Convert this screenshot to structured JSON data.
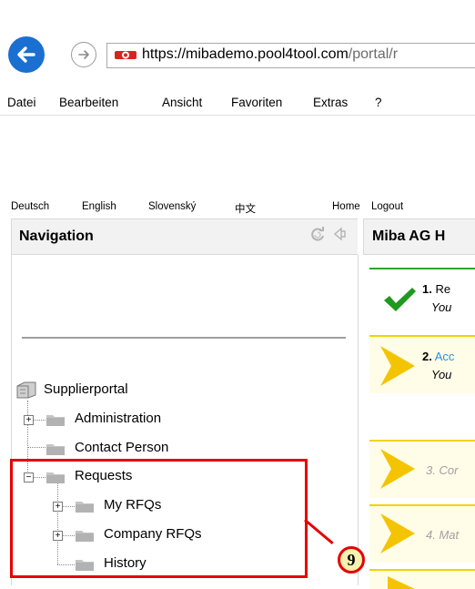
{
  "browser": {
    "url_prefix": "https://mibademo.",
    "url_domain": "pool4tool.com",
    "url_path": "/portal/r",
    "menu": [
      "Datei",
      "Bearbeiten",
      "Ansicht",
      "Favoriten",
      "Extras",
      "?"
    ]
  },
  "languages": [
    "Deutsch",
    "English",
    "Slovenský",
    "中文"
  ],
  "top_links": [
    "Home",
    "Logout"
  ],
  "navigation": {
    "title": "Navigation",
    "tree": {
      "root": "Supplierportal",
      "administration": "Administration",
      "contact_person": "Contact Person",
      "requests": "Requests",
      "my_rfqs": "My RFQs",
      "company_rfqs": "Company RFQs",
      "history": "History"
    },
    "expand_symbol": "+",
    "collapse_symbol": "−"
  },
  "main": {
    "title": "Miba AG H",
    "steps": [
      {
        "num": "1.",
        "label": "Re",
        "sub": "You",
        "status": "done"
      },
      {
        "num": "2.",
        "label": "Acc",
        "sub": "You",
        "status": "active"
      },
      {
        "num": "",
        "label": "3. Cor",
        "sub": "",
        "status": "pending"
      },
      {
        "num": "",
        "label": "4. Mat",
        "sub": "",
        "status": "pending"
      }
    ]
  },
  "annotation": {
    "badge": "9",
    "color": "#e60000"
  },
  "colors": {
    "accent_blue": "#1a6fd1",
    "step_yellow": "#f5c400",
    "check_green": "#1e9a1e",
    "link_blue": "#2a8fd8"
  }
}
